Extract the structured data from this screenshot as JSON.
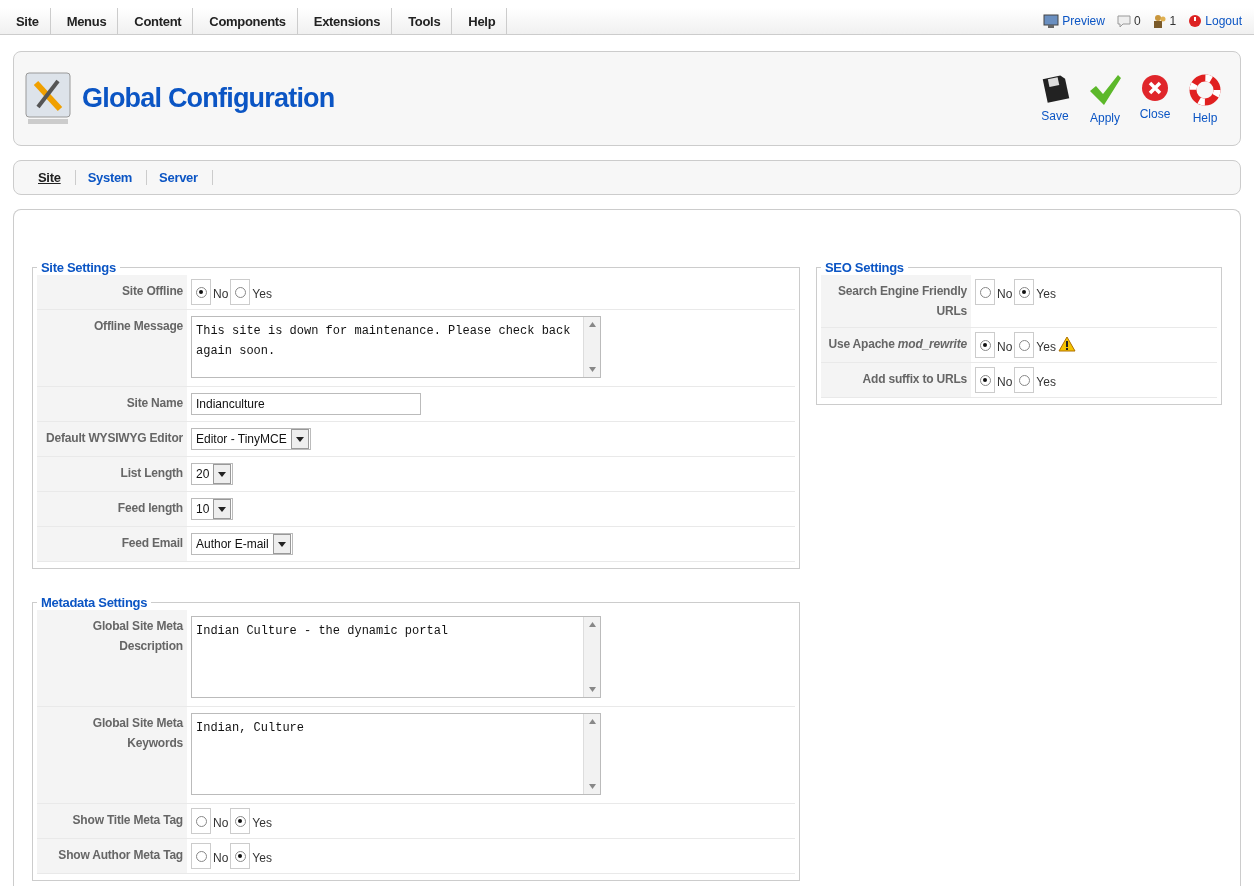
{
  "menu": [
    {
      "label": "Site"
    },
    {
      "label": "Menus"
    },
    {
      "label": "Content"
    },
    {
      "label": "Components"
    },
    {
      "label": "Extensions"
    },
    {
      "label": "Tools"
    },
    {
      "label": "Help"
    }
  ],
  "status_links": [
    {
      "kind": "preview",
      "label": "Preview"
    },
    {
      "kind": "messages",
      "label": "0"
    },
    {
      "kind": "users",
      "label": "1"
    },
    {
      "kind": "logout",
      "label": "Logout"
    }
  ],
  "header": {
    "title": "Global Configuration",
    "toolbar": [
      {
        "kind": "save",
        "label": "Save"
      },
      {
        "kind": "apply",
        "label": "Apply"
      },
      {
        "kind": "close",
        "label": "Close"
      },
      {
        "kind": "help",
        "label": "Help"
      }
    ]
  },
  "subtabs": [
    {
      "label": "Site",
      "selected": true
    },
    {
      "label": "System",
      "selected": false
    },
    {
      "label": "Server",
      "selected": false
    }
  ],
  "left_sections": [
    {
      "title": "Site Settings",
      "rows": [
        {
          "kind": "radio",
          "label": "Site Offline",
          "options": [
            {
              "label": "No",
              "selected": true
            },
            {
              "label": "Yes",
              "selected": false
            }
          ]
        },
        {
          "kind": "textarea",
          "label": "Offline Message",
          "value": "This site is down for maintenance. Please check back again soon."
        },
        {
          "kind": "text",
          "label": "Site Name",
          "value": "Indianculture"
        },
        {
          "kind": "select",
          "label": "Default WYSIWYG Editor",
          "value": "Editor - TinyMCE"
        },
        {
          "kind": "select",
          "label": "List Length",
          "value": "20"
        },
        {
          "kind": "select",
          "label": "Feed length",
          "value": "10"
        },
        {
          "kind": "select",
          "label": "Feed Email",
          "value": "Author E-mail"
        }
      ]
    },
    {
      "title": "Metadata Settings",
      "rows": [
        {
          "kind": "textarea",
          "label": "Global Site Meta Description",
          "value": "Indian Culture - the dynamic portal"
        },
        {
          "kind": "textarea",
          "label": "Global Site Meta Keywords",
          "value": "Indian, Culture"
        },
        {
          "kind": "radio",
          "label": "Show Title Meta Tag",
          "options": [
            {
              "label": "No",
              "selected": false
            },
            {
              "label": "Yes",
              "selected": true
            }
          ]
        },
        {
          "kind": "radio",
          "label": "Show Author Meta Tag",
          "options": [
            {
              "label": "No",
              "selected": false
            },
            {
              "label": "Yes",
              "selected": true
            }
          ]
        }
      ]
    }
  ],
  "right_sections": [
    {
      "title": "SEO Settings",
      "rows": [
        {
          "kind": "radio",
          "label": "Search Engine Friendly URLs",
          "options": [
            {
              "label": "No",
              "selected": false
            },
            {
              "label": "Yes",
              "selected": true
            }
          ]
        },
        {
          "kind": "radio",
          "label": "Use Apache *mod_rewrite*",
          "warning": true,
          "options": [
            {
              "label": "No",
              "selected": true
            },
            {
              "label": "Yes",
              "selected": false
            }
          ]
        },
        {
          "kind": "radio",
          "label": "Add suffix to URLs",
          "options": [
            {
              "label": "No",
              "selected": true
            },
            {
              "label": "Yes",
              "selected": false
            }
          ]
        }
      ]
    }
  ]
}
